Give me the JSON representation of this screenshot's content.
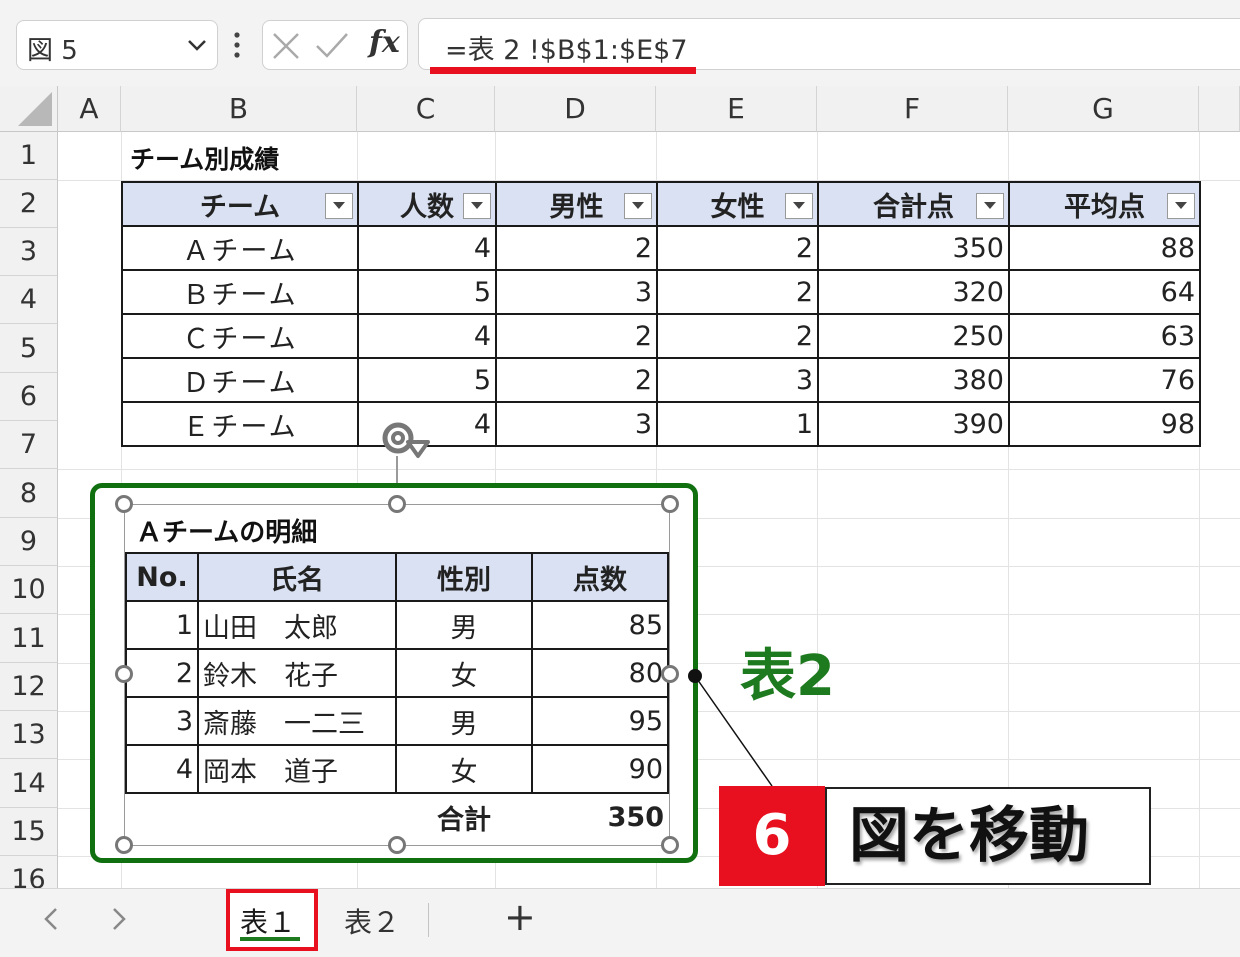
{
  "formula_bar": {
    "name_box": "図 5",
    "formula": "=表 2 !$B$1:$E$7",
    "fx_label": "fx"
  },
  "columns": [
    "A",
    "B",
    "C",
    "D",
    "E",
    "F",
    "G"
  ],
  "rows": [
    "1",
    "2",
    "3",
    "4",
    "5",
    "6",
    "7",
    "8",
    "9",
    "10",
    "11",
    "12",
    "13",
    "14",
    "15",
    "16"
  ],
  "main_table": {
    "title": "チーム別成績",
    "headers": [
      "チーム",
      "人数",
      "男性",
      "女性",
      "合計点",
      "平均点"
    ],
    "rows": [
      [
        "Ａチーム",
        "4",
        "2",
        "2",
        "350",
        "88"
      ],
      [
        "Ｂチーム",
        "5",
        "3",
        "2",
        "320",
        "64"
      ],
      [
        "Ｃチーム",
        "4",
        "2",
        "2",
        "250",
        "63"
      ],
      [
        "Ｄチーム",
        "5",
        "2",
        "3",
        "380",
        "76"
      ],
      [
        "Ｅチーム",
        "4",
        "3",
        "1",
        "390",
        "98"
      ]
    ]
  },
  "picture": {
    "title": "Ａチームの明細",
    "headers": [
      "No.",
      "氏名",
      "性別",
      "点数"
    ],
    "rows": [
      [
        "1",
        "山田　太郎",
        "男",
        "85"
      ],
      [
        "2",
        "鈴木　花子",
        "女",
        "80"
      ],
      [
        "3",
        "斎藤　一二三",
        "男",
        "95"
      ],
      [
        "4",
        "岡本　道子",
        "女",
        "90"
      ]
    ],
    "total_label": "合計",
    "total_value": "350"
  },
  "annotations": {
    "picture_label": "表2",
    "step_number": "6",
    "step_text": "図を移動"
  },
  "sheet_tabs": {
    "tab1": "表１",
    "tab2": "表２",
    "add": "+"
  },
  "colors": {
    "highlight_red": "#e8101e",
    "frame_green": "#107010",
    "header_blue": "#d9e1f2"
  }
}
